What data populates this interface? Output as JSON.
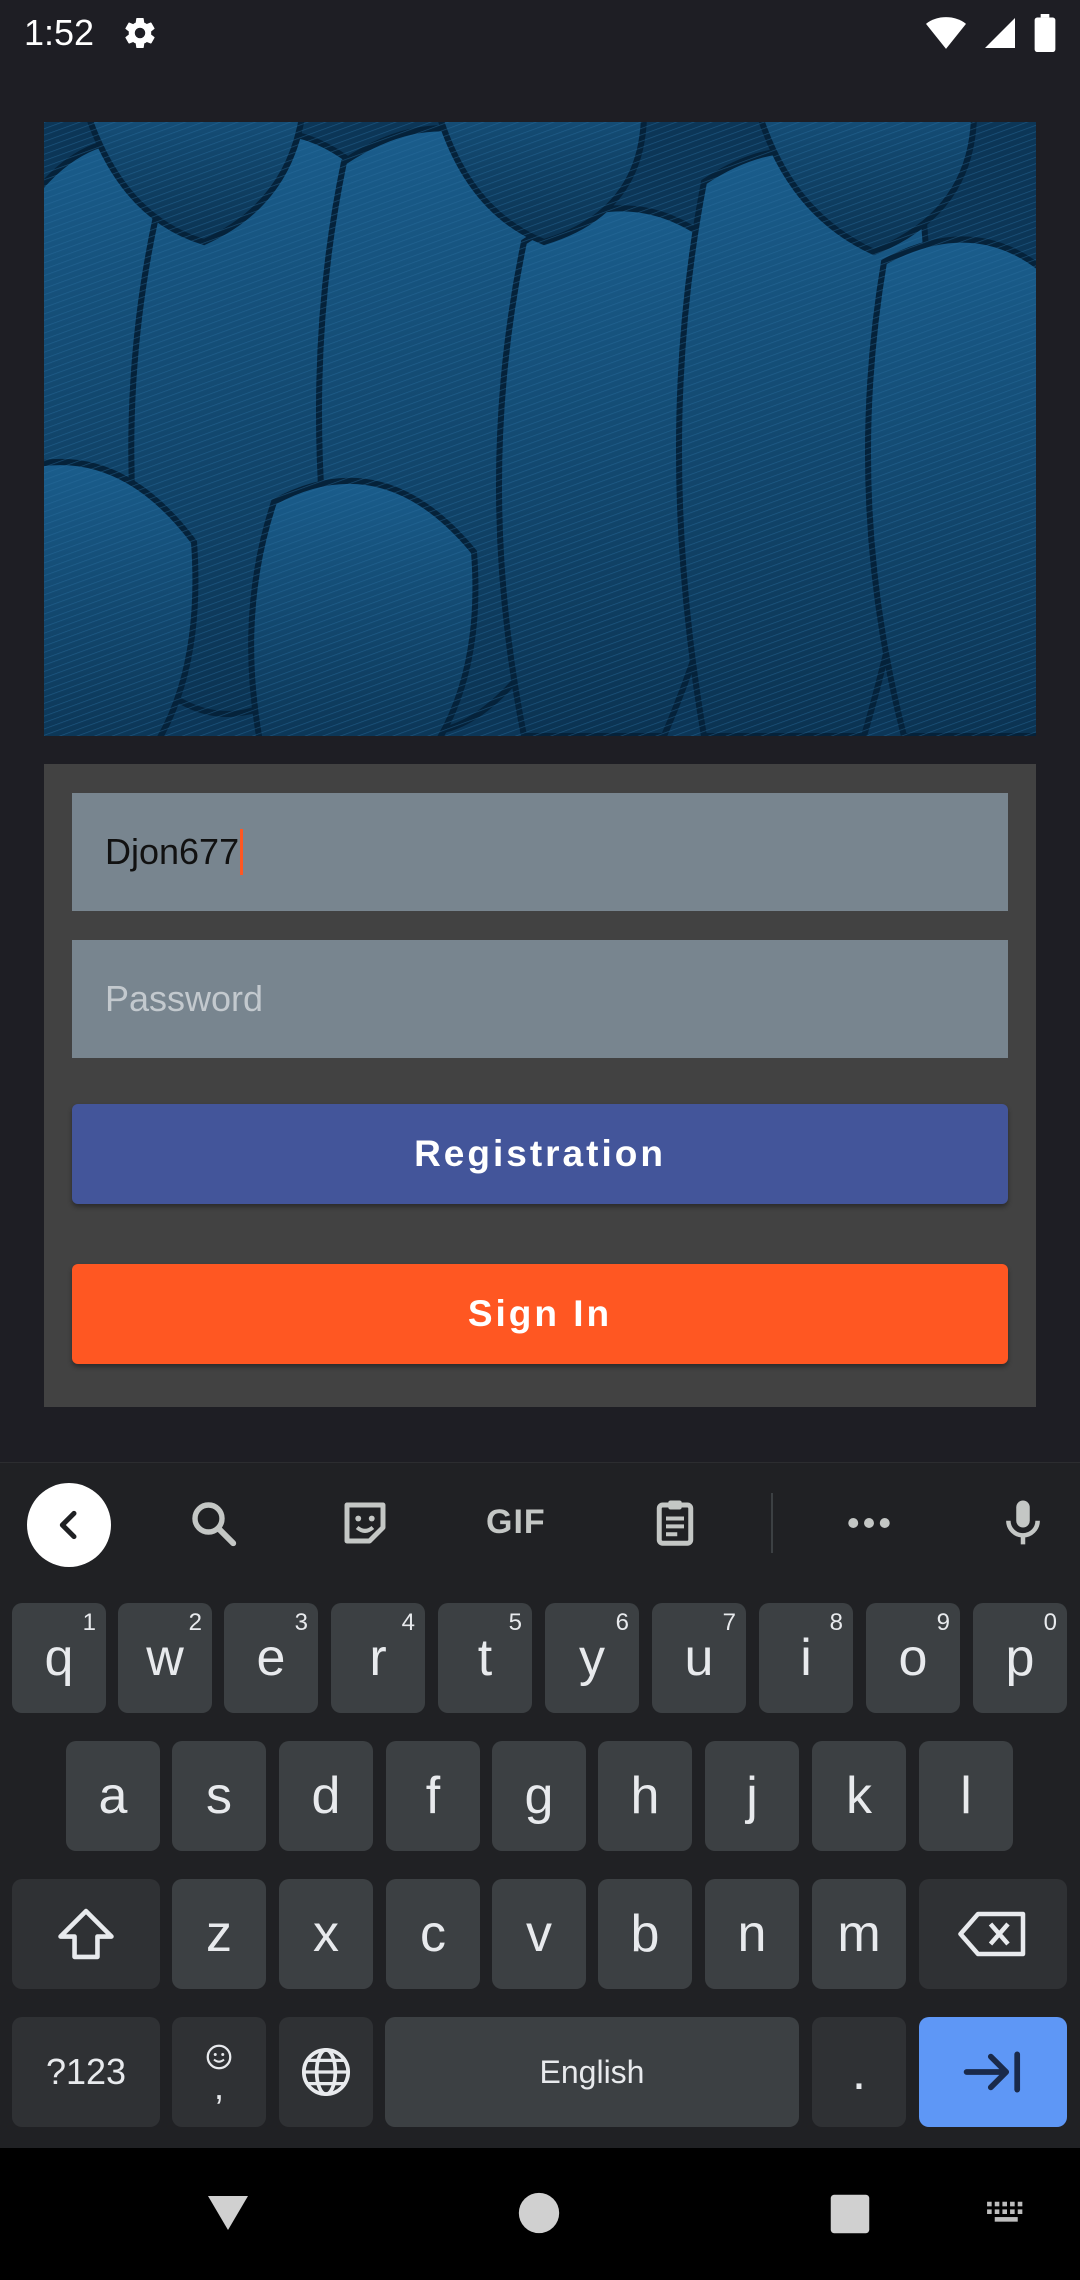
{
  "status_bar": {
    "time": "1:52",
    "icons": [
      "settings-gear-icon",
      "wifi-icon",
      "cell-signal-icon",
      "battery-icon"
    ]
  },
  "hero": {
    "image": "blue-feathers-photo"
  },
  "form": {
    "username_value": "Djon677",
    "password_placeholder": "Password",
    "registration_label": "Registration",
    "signin_label": "Sign In"
  },
  "keyboard": {
    "toolbar": {
      "gif_label": "GIF",
      "icons": [
        "back-chevron-icon",
        "search-icon",
        "sticker-icon",
        "gif-icon",
        "clipboard-icon",
        "more-icon",
        "mic-icon"
      ]
    },
    "row1": [
      {
        "key": "q",
        "hint": "1"
      },
      {
        "key": "w",
        "hint": "2"
      },
      {
        "key": "e",
        "hint": "3"
      },
      {
        "key": "r",
        "hint": "4"
      },
      {
        "key": "t",
        "hint": "5"
      },
      {
        "key": "y",
        "hint": "6"
      },
      {
        "key": "u",
        "hint": "7"
      },
      {
        "key": "i",
        "hint": "8"
      },
      {
        "key": "o",
        "hint": "9"
      },
      {
        "key": "p",
        "hint": "0"
      }
    ],
    "row2": [
      "a",
      "s",
      "d",
      "f",
      "g",
      "h",
      "j",
      "k",
      "l"
    ],
    "row3": [
      "z",
      "x",
      "c",
      "v",
      "b",
      "n",
      "m"
    ],
    "symbols_label": "?123",
    "comma_label": ",",
    "space_label": "English",
    "period_label": "."
  },
  "colors": {
    "background": "#1e1e24",
    "card": "#424242",
    "field": "#78858f",
    "registration": "#43559a",
    "signin": "#ff5722",
    "keyboard_action": "#5e97f6"
  }
}
